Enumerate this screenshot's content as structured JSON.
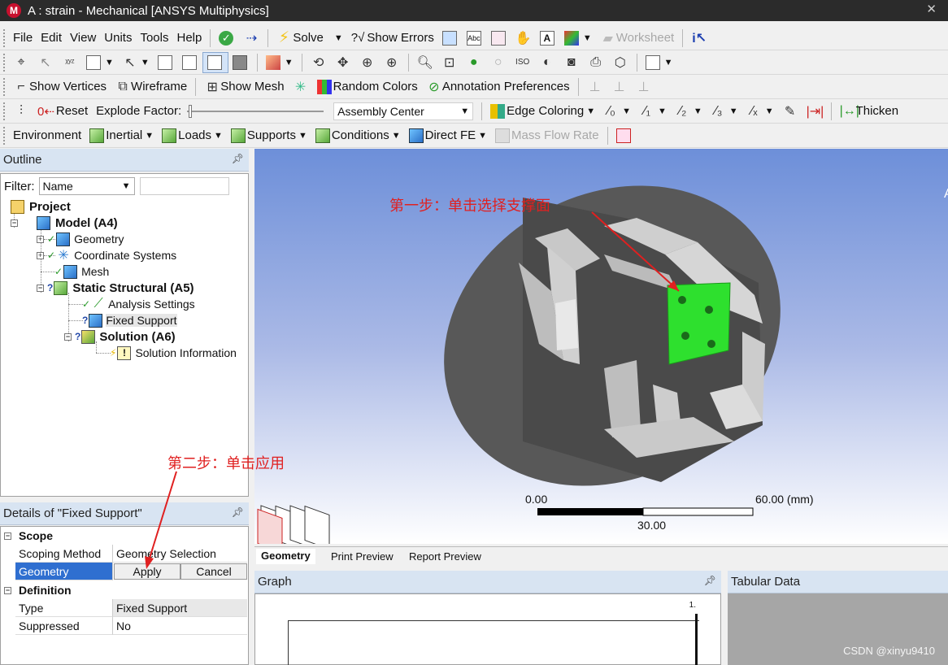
{
  "window": {
    "title": "A : strain - Mechanical [ANSYS Multiphysics]",
    "logo": "M"
  },
  "menu": [
    "File",
    "Edit",
    "View",
    "Units",
    "Tools",
    "Help"
  ],
  "toolbar1": {
    "solve": "Solve",
    "show_errors": "Show Errors",
    "worksheet": "Worksheet"
  },
  "toolbar3": {
    "show_vertices": "Show Vertices",
    "wireframe": "Wireframe",
    "show_mesh": "Show Mesh",
    "random_colors": "Random Colors",
    "annotation_prefs": "Annotation Preferences"
  },
  "toolbar4": {
    "reset": "Reset",
    "explode_factor": "Explode Factor:",
    "assembly_center": "Assembly Center",
    "edge_coloring": "Edge Coloring",
    "thicken": "Thicken"
  },
  "toolbar5": {
    "environment": "Environment",
    "inertial": "Inertial",
    "loads": "Loads",
    "supports": "Supports",
    "conditions": "Conditions",
    "direct_fe": "Direct FE",
    "mass_flow_rate": "Mass Flow Rate"
  },
  "outline": {
    "title": "Outline",
    "filter_label": "Filter:",
    "filter_value": "Name",
    "tree": {
      "project": "Project",
      "model": "Model (A4)",
      "geometry": "Geometry",
      "coordinate_systems": "Coordinate Systems",
      "mesh": "Mesh",
      "static_structural": "Static Structural (A5)",
      "analysis_settings": "Analysis Settings",
      "fixed_support": "Fixed Support",
      "solution": "Solution (A6)",
      "solution_information": "Solution Information"
    }
  },
  "details": {
    "title": "Details of \"Fixed Support\"",
    "scope": "Scope",
    "scoping_method_label": "Scoping Method",
    "scoping_method_value": "Geometry Selection",
    "geometry_label": "Geometry",
    "apply": "Apply",
    "cancel": "Cancel",
    "definition": "Definition",
    "type_label": "Type",
    "type_value": "Fixed Support",
    "suppressed_label": "Suppressed",
    "suppressed_value": "No"
  },
  "viewport": {
    "scale_left": "0.00",
    "scale_right": "60.00 (mm)",
    "scale_mid": "30.00",
    "annotation_step1": "第一步：单击选择支撑面",
    "annotation_step2": "第二步：单击应用",
    "selected_face_color": "#2ee02e",
    "annotation_color": "#e02020"
  },
  "view_tabs": [
    "Geometry",
    "Print Preview",
    "Report Preview"
  ],
  "bottom": {
    "graph": "Graph",
    "tabular_data": "Tabular Data",
    "graph_tick": "1."
  },
  "watermark": "CSDN @xinyu9410"
}
